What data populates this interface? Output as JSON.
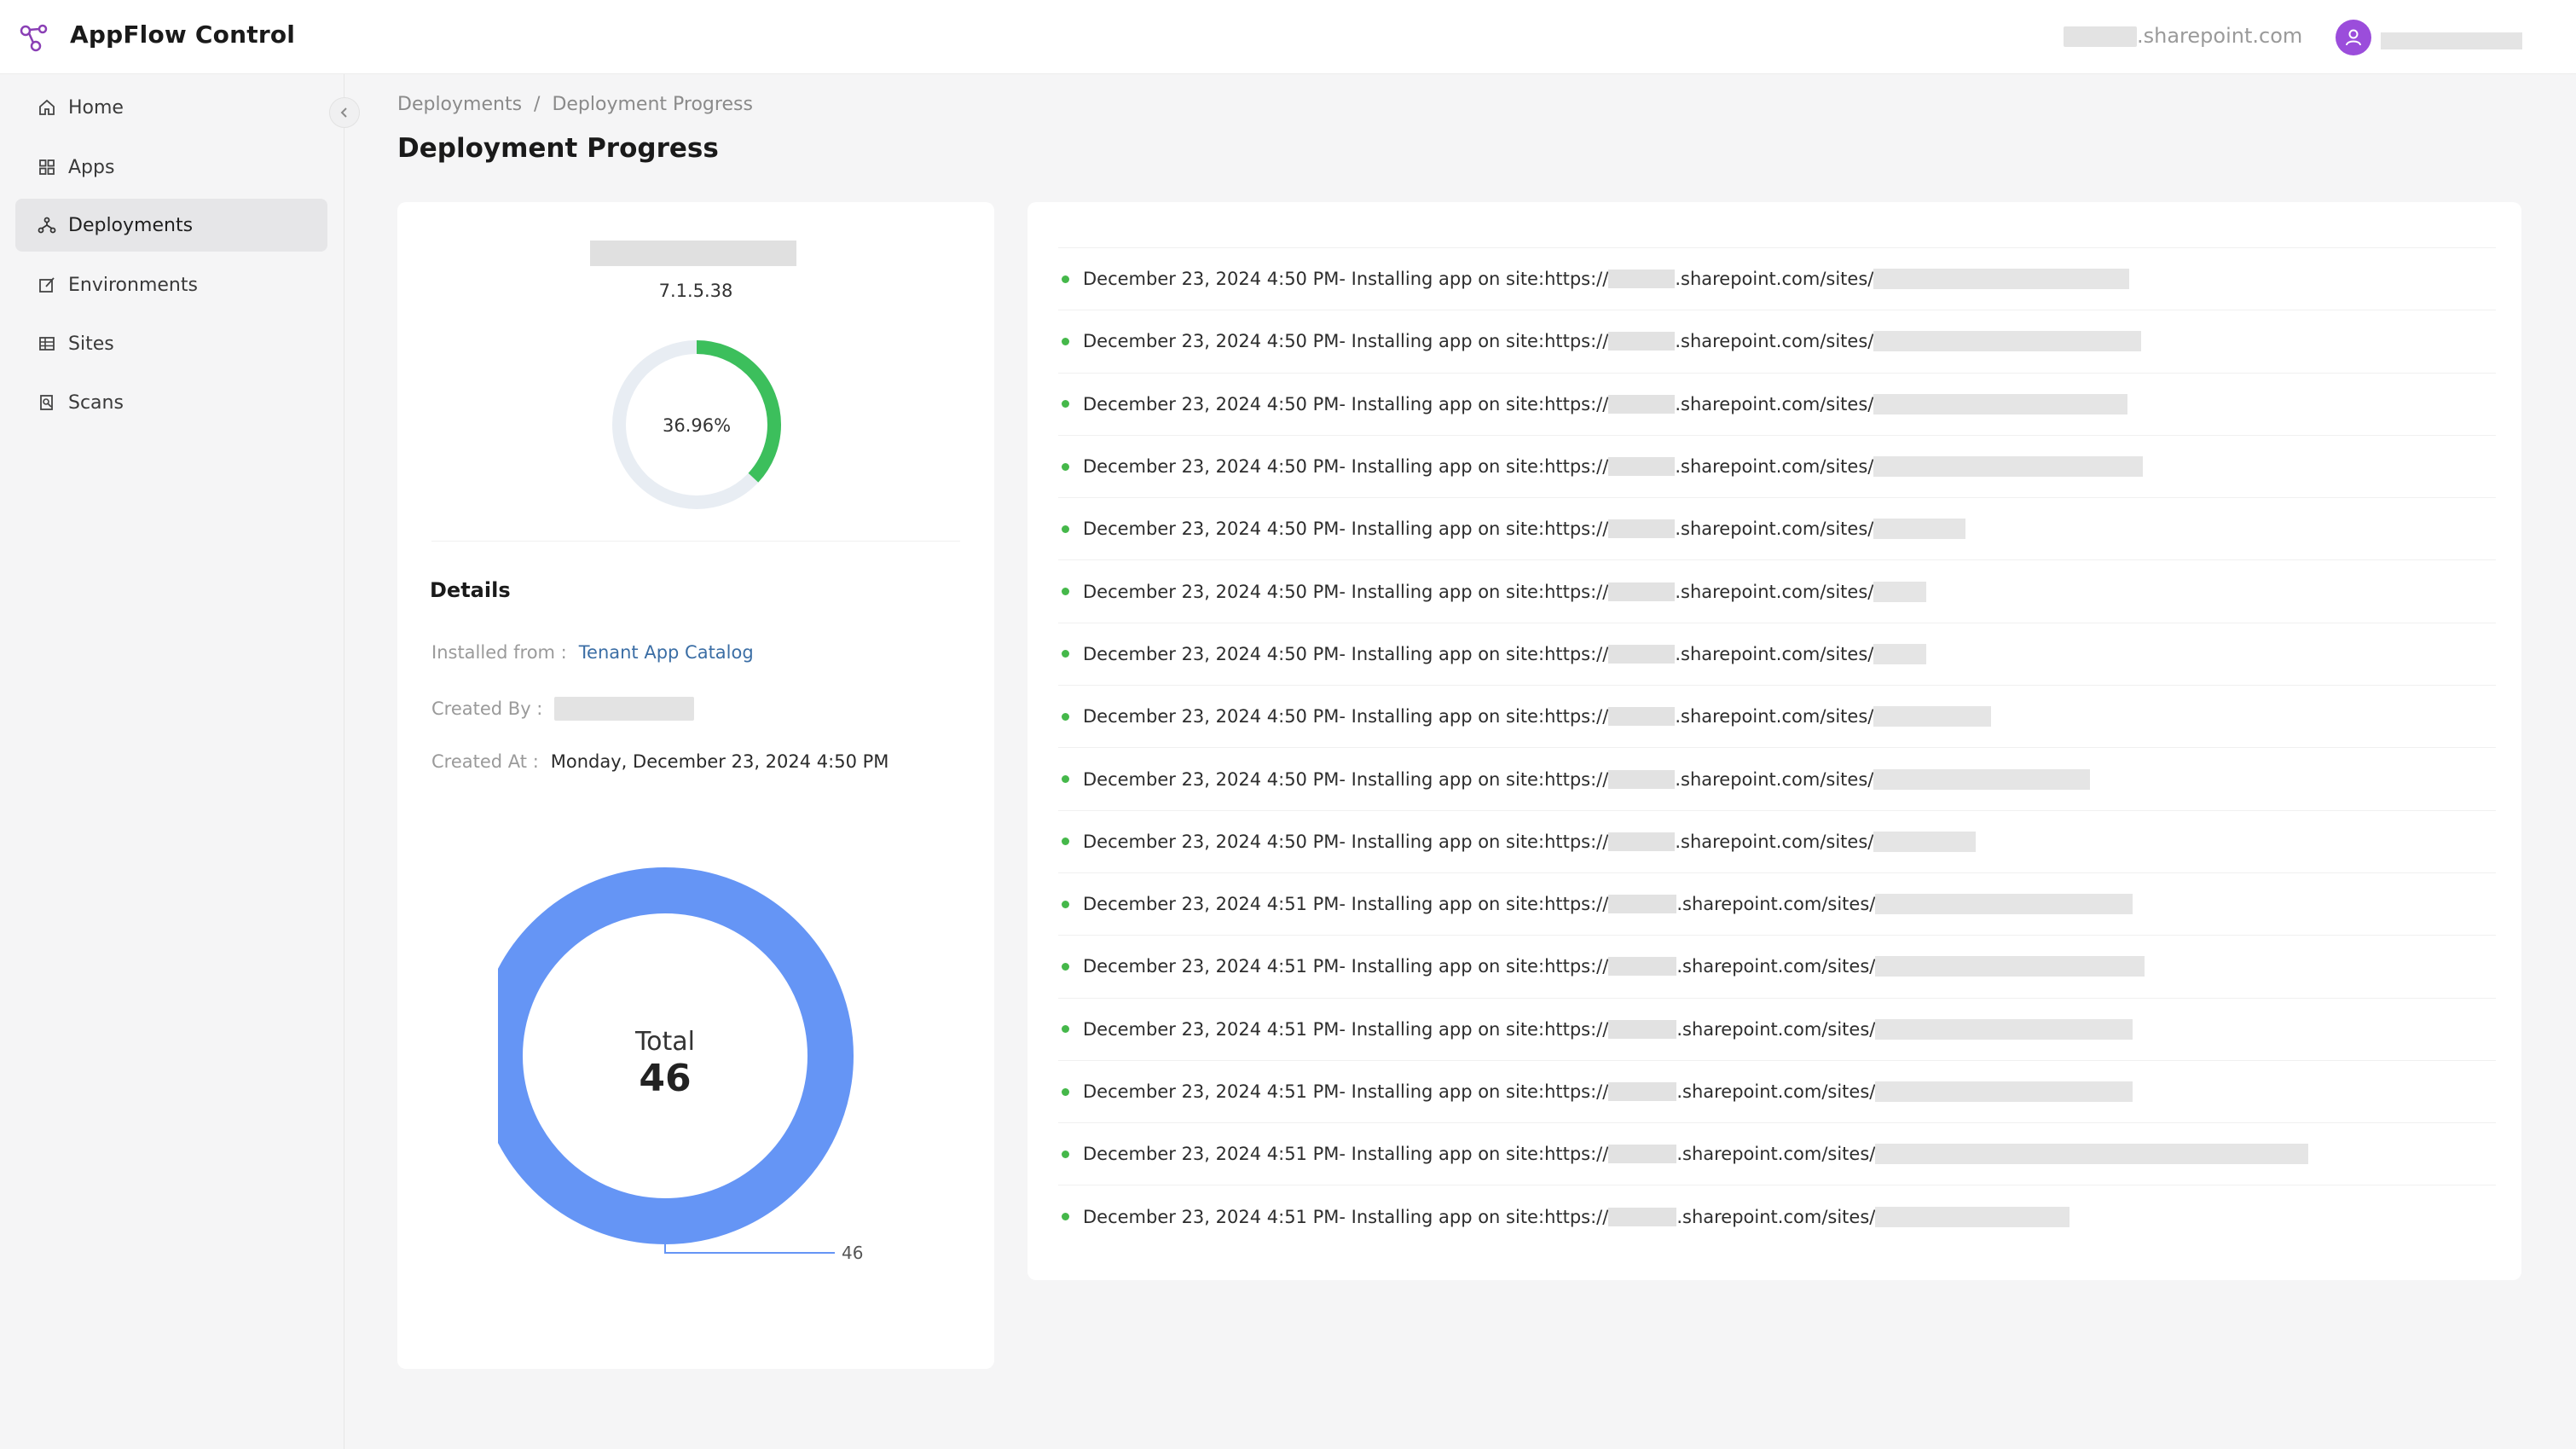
{
  "header": {
    "app_title": "AppFlow Control",
    "tenant_suffix": ".sharepoint.com"
  },
  "sidebar": {
    "items": [
      {
        "label": "Home",
        "icon": "home-icon",
        "active": false
      },
      {
        "label": "Apps",
        "icon": "apps-grid-icon",
        "active": false
      },
      {
        "label": "Deployments",
        "icon": "deployments-icon",
        "active": true
      },
      {
        "label": "Environments",
        "icon": "environments-edit-icon",
        "active": false
      },
      {
        "label": "Sites",
        "icon": "sites-table-icon",
        "active": false
      },
      {
        "label": "Scans",
        "icon": "scans-icon",
        "active": false
      }
    ]
  },
  "breadcrumb": {
    "items": [
      "Deployments",
      "Deployment Progress"
    ],
    "separator": "/"
  },
  "page_title": "Deployment Progress",
  "summary": {
    "version": "7.1.5.38",
    "progress_label": "36.96%",
    "progress_fraction": 0.3696,
    "progress_color": "#3cbf5c"
  },
  "details": {
    "title": "Details",
    "installed_from_label": "Installed from :",
    "installed_from_value": "Tenant App Catalog",
    "created_by_label": "Created By :",
    "created_at_label": "Created At :",
    "created_at_value": "Monday, December 23, 2024 4:50 PM"
  },
  "total_chart": {
    "total_label": "Total",
    "total_value": "46",
    "slice_label": "46",
    "color": "#6595f5"
  },
  "log": {
    "prefix": "https://",
    "domain": ".sharepoint.com/sites/",
    "entries": [
      {
        "time": "December 23, 2024 4:50 PM",
        "text": " - Installing app on site: "
      },
      {
        "time": "December 23, 2024 4:50 PM",
        "text": " - Installing app on site: "
      },
      {
        "time": "December 23, 2024 4:50 PM",
        "text": " - Installing app on site: "
      },
      {
        "time": "December 23, 2024 4:50 PM",
        "text": " - Installing app on site: "
      },
      {
        "time": "December 23, 2024 4:50 PM",
        "text": " - Installing app on site: "
      },
      {
        "time": "December 23, 2024 4:50 PM",
        "text": " - Installing app on site: "
      },
      {
        "time": "December 23, 2024 4:50 PM",
        "text": " - Installing app on site: "
      },
      {
        "time": "December 23, 2024 4:50 PM",
        "text": " - Installing app on site: "
      },
      {
        "time": "December 23, 2024 4:50 PM",
        "text": " - Installing app on site: "
      },
      {
        "time": "December 23, 2024 4:50 PM",
        "text": " - Installing app on site: "
      },
      {
        "time": "December 23, 2024 4:51 PM",
        "text": " - Installing app on site: "
      },
      {
        "time": "December 23, 2024 4:51 PM",
        "text": " - Installing app on site: "
      },
      {
        "time": "December 23, 2024 4:51 PM",
        "text": " - Installing app on site: "
      },
      {
        "time": "December 23, 2024 4:51 PM",
        "text": " - Installing app on site: "
      },
      {
        "time": "December 23, 2024 4:51 PM",
        "text": " - Installing app on site: "
      },
      {
        "time": "December 23, 2024 4:51 PM",
        "text": " - Installing app on site: "
      }
    ]
  }
}
